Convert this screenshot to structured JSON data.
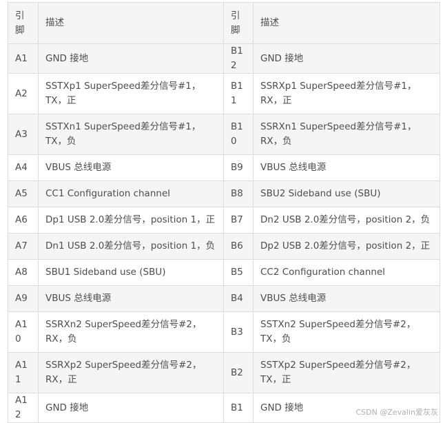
{
  "header": {
    "pin_a": "引\n脚",
    "desc_a": "描述",
    "pin_b": "引\n脚",
    "desc_b": "描述"
  },
  "rows": [
    {
      "pin_a": "A1",
      "desc_a": "GND 接地",
      "pin_b": "B12",
      "desc_b": "GND 接地"
    },
    {
      "pin_a": "A2",
      "desc_a": "SSTXp1 SuperSpeed差分信号#1，TX，正",
      "pin_b": "B11",
      "desc_b": "SSRXp1 SuperSpeed差分信号#1，RX，正"
    },
    {
      "pin_a": "A3",
      "desc_a": "SSTXn1 SuperSpeed差分信号#1，TX，负",
      "pin_b": "B10",
      "desc_b": "SSRXn1 SuperSpeed差分信号#1，RX，负"
    },
    {
      "pin_a": "A4",
      "desc_a": "VBUS 总线电源",
      "pin_b": "B9",
      "desc_b": "VBUS 总线电源"
    },
    {
      "pin_a": "A5",
      "desc_a": "CC1 Configuration channel",
      "pin_b": "B8",
      "desc_b": "SBU2 Sideband use (SBU)"
    },
    {
      "pin_a": "A6",
      "desc_a": "Dp1 USB 2.0差分信号，position 1，正",
      "pin_b": "B7",
      "desc_b": "Dn2 USB 2.0差分信号，position 2，负"
    },
    {
      "pin_a": "A7",
      "desc_a": "Dn1 USB 2.0差分信号，position 1，负",
      "pin_b": "B6",
      "desc_b": "Dp2 USB 2.0差分信号，position 2，正"
    },
    {
      "pin_a": "A8",
      "desc_a": "SBU1 Sideband use (SBU)",
      "pin_b": "B5",
      "desc_b": "CC2 Configuration channel"
    },
    {
      "pin_a": "A9",
      "desc_a": "VBUS 总线电源",
      "pin_b": "B4",
      "desc_b": "VBUS 总线电源"
    },
    {
      "pin_a": "A10",
      "desc_a": "SSRXn2 SuperSpeed差分信号#2，RX，负",
      "pin_b": "B3",
      "desc_b": "SSTXn2 SuperSpeed差分信号#2，TX，负"
    },
    {
      "pin_a": "A11",
      "desc_a": "SSRXp2 SuperSpeed差分信号#2，RX，正",
      "pin_b": "B2",
      "desc_b": "SSTXp2 SuperSpeed差分信号#2，TX，正"
    },
    {
      "pin_a": "A12",
      "desc_a": "GND 接地",
      "pin_b": "B1",
      "desc_b": "GND 接地"
    }
  ],
  "watermark": "CSDN @Zevalin爱灰灰"
}
